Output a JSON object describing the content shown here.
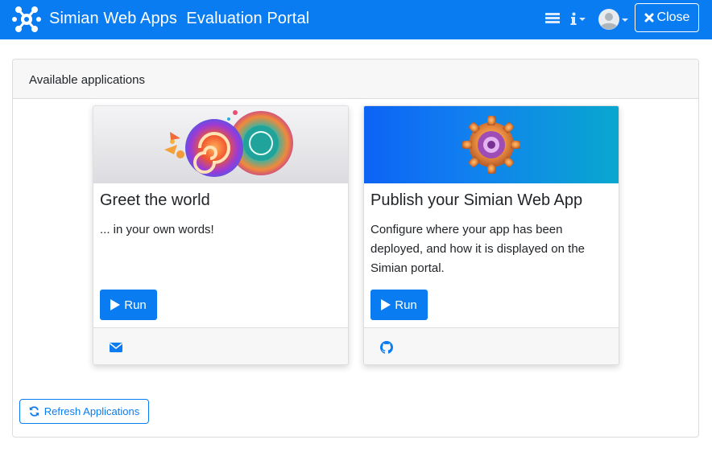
{
  "header": {
    "app_title": "Simian Web Apps  Evaluation Portal",
    "close_label": "Close",
    "icons": [
      "simian-logo",
      "layout-icon",
      "info-icon",
      "user-avatar-icon",
      "close-x-icon"
    ]
  },
  "main": {
    "header_title": "Available applications",
    "refresh_label": "Refresh Applications",
    "apps": [
      {
        "title": "Greet the world",
        "description": "... in your own words!",
        "run_label": "Run",
        "footer_icon": "envelope-icon"
      },
      {
        "title": "Publish your Simian Web App",
        "description": "Configure where your app has been deployed, and how it is displayed on the Simian portal.",
        "run_label": "Run",
        "footer_icon": "github-icon"
      }
    ]
  },
  "colors": {
    "primary": "#0a7cf2",
    "card_header_bg": "#f7f7f7",
    "border": "#dcdcdc"
  }
}
